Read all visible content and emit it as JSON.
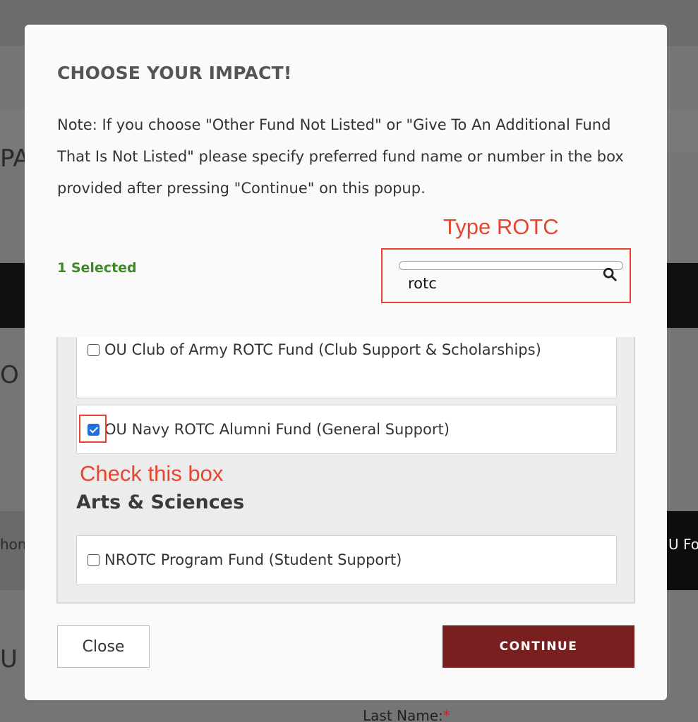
{
  "background": {
    "left_fragment_1": "PA",
    "left_fragment_2": "O",
    "left_fragment_3": "hom",
    "right_fragment": "U Fo",
    "left_fragment_4": "U",
    "last_name_label": "Last Name:",
    "required_marker": "*"
  },
  "modal": {
    "title": "CHOOSE YOUR IMPACT!",
    "note": "Note: If you choose \"Other Fund Not Listed\" or \"Give To An Additional Fund That Is Not Listed\" please specify preferred fund name or number in the box provided after pressing \"Continue\" on this popup.",
    "selected_count": "1 Selected",
    "search": {
      "value": "rotc",
      "icon": "search-icon"
    },
    "funds": [
      {
        "label": "OU Club of Army ROTC Fund (Club Support & Scholarships)",
        "checked": false
      },
      {
        "label": "OU Navy ROTC Alumni Fund (General Support)",
        "checked": true
      }
    ],
    "section_heading": "Arts & Sciences",
    "section_funds": [
      {
        "label": "NROTC Program Fund (Student Support)",
        "checked": false
      }
    ],
    "close_label": "Close",
    "continue_label": "CONTINUE"
  },
  "annotations": {
    "type_hint": "Type ROTC",
    "check_hint": "Check this box",
    "color": "#e6452e"
  },
  "colors": {
    "accent": "#7a1f1f",
    "selected_text": "#3a8a25",
    "checkbox": "#1f6fe0"
  }
}
